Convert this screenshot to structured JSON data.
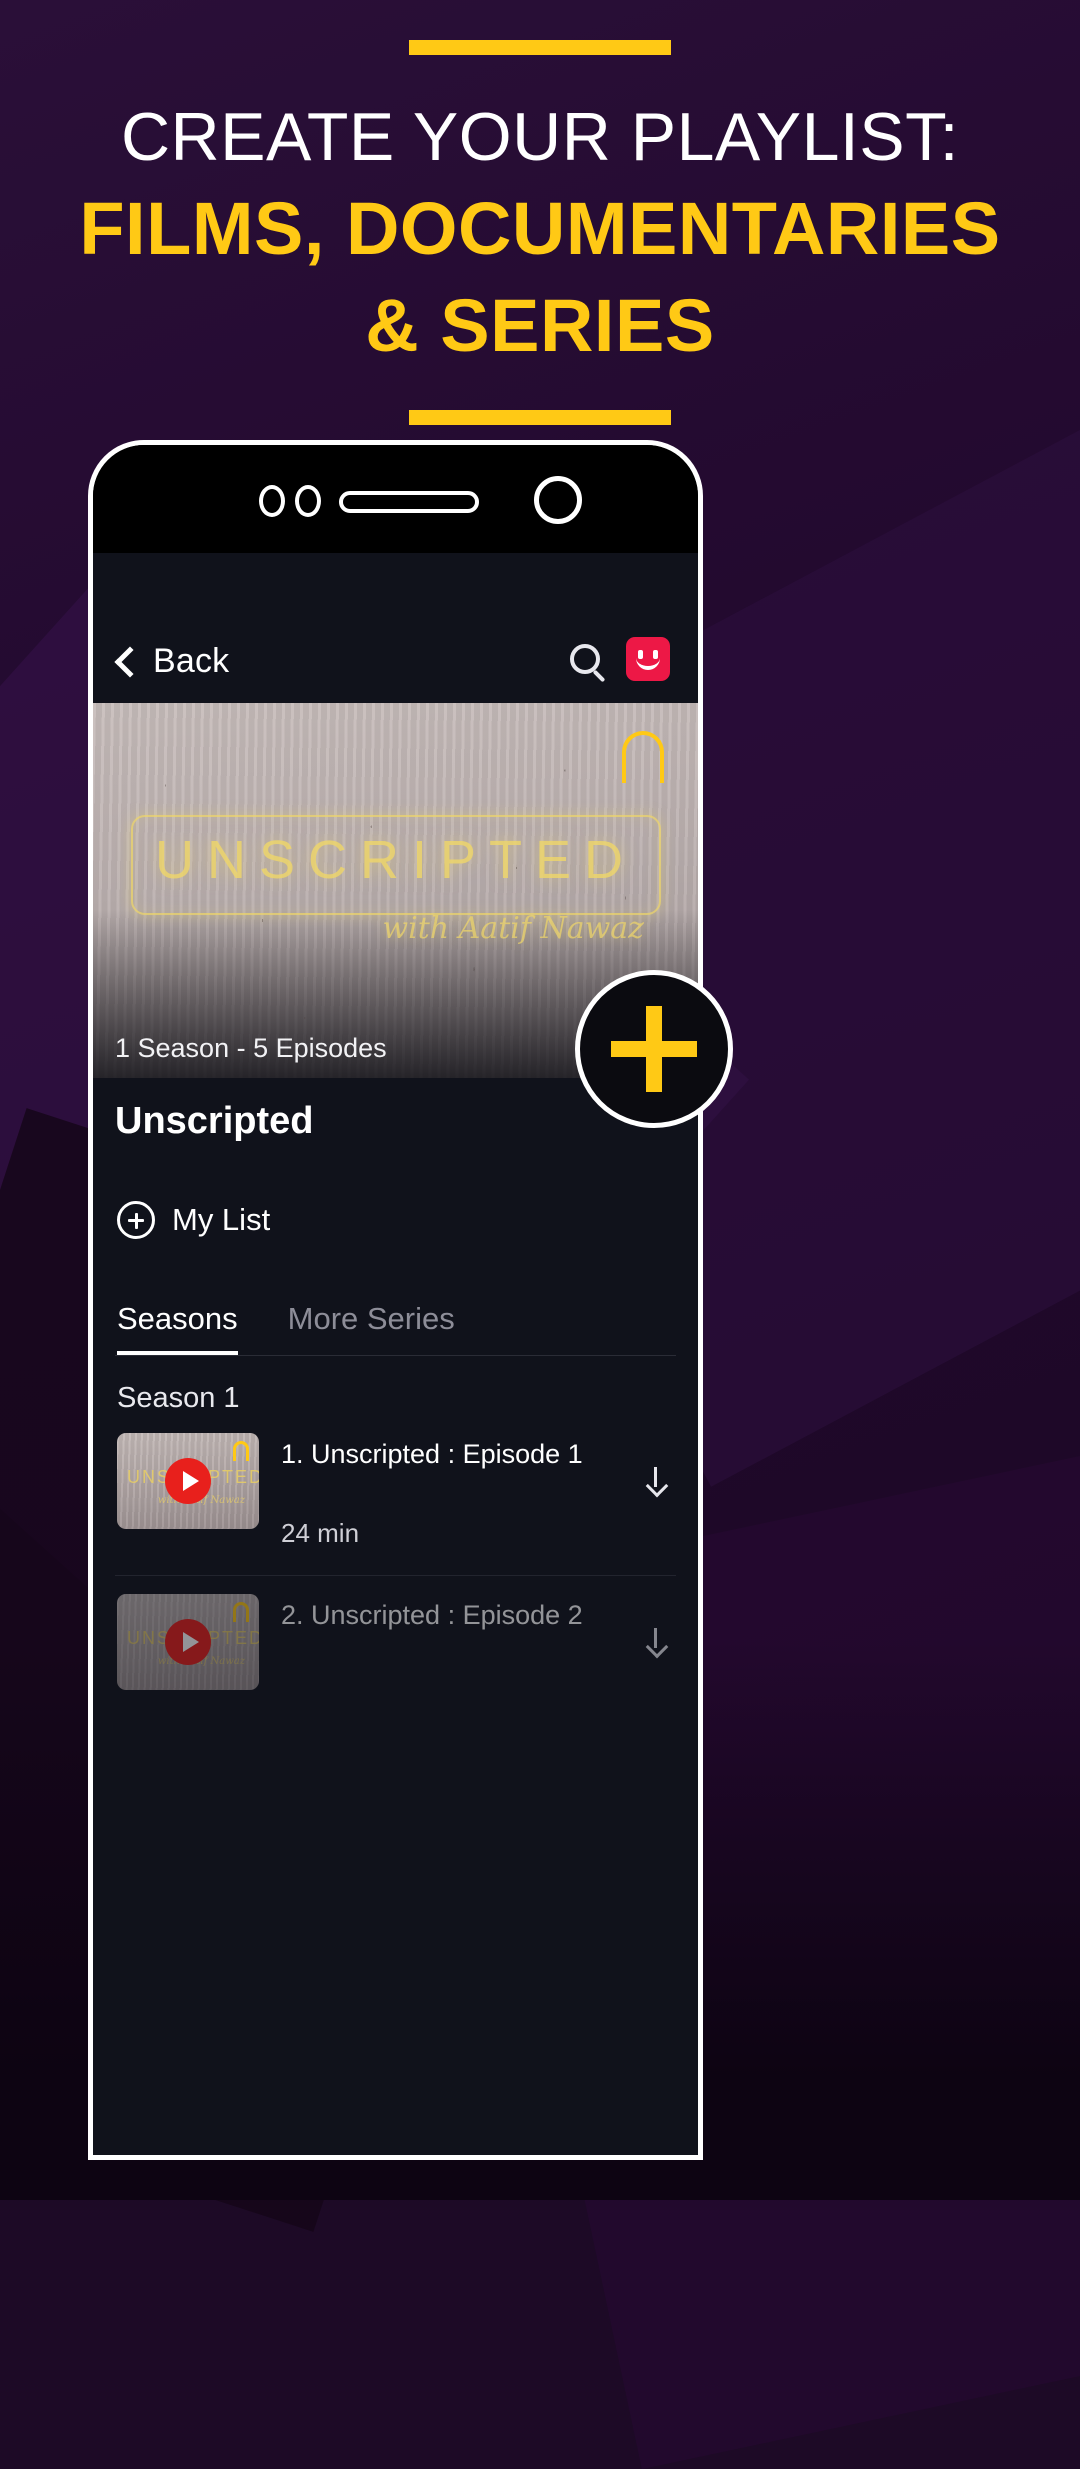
{
  "promo": {
    "headline_line1": "CREATE YOUR PLAYLIST:",
    "headline_line2": "FILMS, DOCUMENTARIES",
    "headline_line3": "& SERIES",
    "accent_color": "#FFC915",
    "headline_color": "#FFFFFF",
    "background_color": "#1d0a26"
  },
  "phone": {
    "camera_icon": "camera-dots-icon",
    "speaker_icon": "speaker-slot-icon",
    "front_camera_icon": "front-camera-icon"
  },
  "app": {
    "navbar": {
      "back_label": "Back",
      "back_icon": "chevron-left-icon",
      "search_icon": "search-icon",
      "profile_icon": "smiley-avatar-icon",
      "profile_color": "#ED1846"
    },
    "hero": {
      "neon_title": "UNSCRIPTED",
      "neon_subtitle": "with Aatif Nawaz",
      "badge_icon": "arch-badge-icon",
      "badge_color": "#FFC915",
      "meta": "1 Season - 5 Episodes"
    },
    "detail": {
      "show_title": "Unscripted",
      "my_list_label": "My List",
      "my_list_icon": "plus-circle-icon",
      "tabs": [
        {
          "label": "Seasons",
          "active": true
        },
        {
          "label": "More Series",
          "active": false
        }
      ],
      "season_label": "Season 1",
      "episodes": [
        {
          "title": "1. Unscripted : Episode 1",
          "duration": "24 min",
          "play_icon": "play-button-icon",
          "download_icon": "download-icon",
          "thumb_title": "UNSCRIPTED",
          "thumb_subtitle": "with Aatif Nawaz"
        },
        {
          "title": "2. Unscripted : Episode 2",
          "duration": "",
          "play_icon": "play-button-icon",
          "download_icon": "download-icon",
          "thumb_title": "UNSCRIPTED",
          "thumb_subtitle": "with Aatif Nawaz"
        }
      ]
    },
    "fab": {
      "icon": "plus-icon",
      "color": "#FFC915"
    }
  }
}
